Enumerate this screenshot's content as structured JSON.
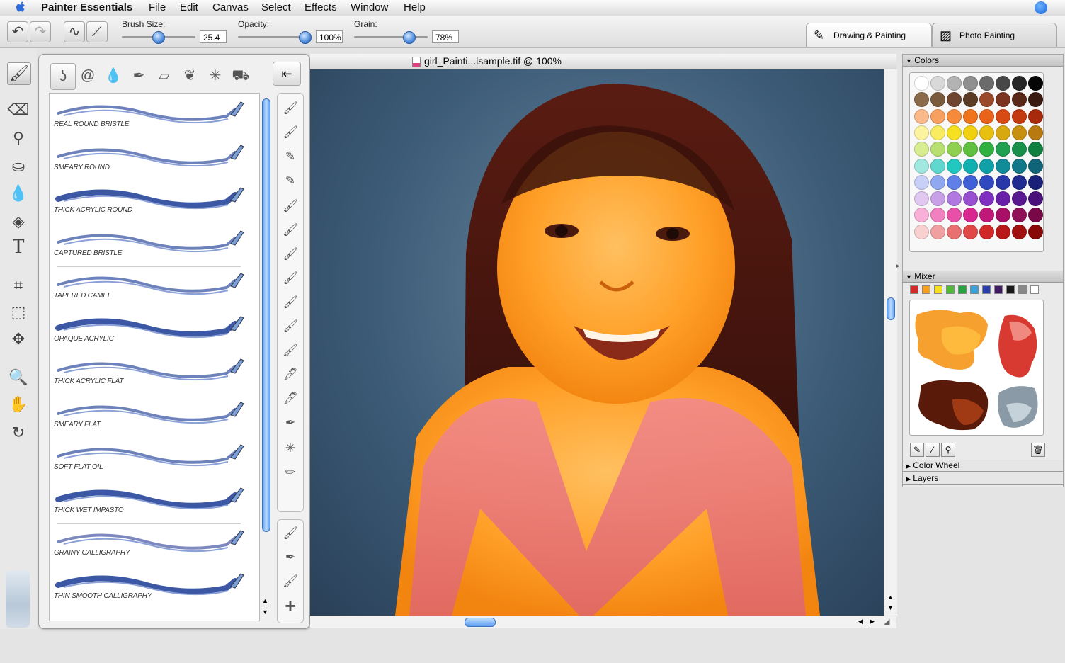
{
  "menubar": {
    "app": "Painter Essentials",
    "items": [
      "File",
      "Edit",
      "Canvas",
      "Select",
      "Effects",
      "Window",
      "Help"
    ]
  },
  "toolbar": {
    "brush_size_label": "Brush Size:",
    "brush_size_value": "25.4",
    "opacity_label": "Opacity:",
    "opacity_value": "100%",
    "grain_label": "Grain:",
    "grain_value": "78%",
    "workspace_tabs": [
      "Drawing & Painting",
      "Photo Painting"
    ]
  },
  "document": {
    "title": "girl_Painti...lsample.tif @ 100%"
  },
  "brushes": [
    "REAL ROUND BRISTLE",
    "SMEARY ROUND",
    "THICK ACRYLIC ROUND",
    "CAPTURED BRISTLE",
    "TAPERED CAMEL",
    "OPAQUE ACRYLIC",
    "THICK ACRYLIC FLAT",
    "SMEARY FLAT",
    "SOFT FLAT OIL",
    "THICK WET IMPASTO",
    "GRAINY CALLIGRAPHY",
    "THIN SMOOTH CALLIGRAPHY"
  ],
  "panels": {
    "colors": "Colors",
    "mixer": "Mixer",
    "color_wheel": "Color Wheel",
    "layers": "Layers"
  },
  "colors": {
    "swatch_rows": [
      [
        "#ffffff",
        "#d9d9d9",
        "#b3b3b3",
        "#8f8f8f",
        "#6b6b6b",
        "#474747",
        "#262626",
        "#050505"
      ],
      [
        "#8a6a4a",
        "#7a5a3c",
        "#6e4630",
        "#5a3c26",
        "#9a4a2a",
        "#7a3420",
        "#5a2818",
        "#3a1a10"
      ],
      [
        "#f9b98a",
        "#f7a060",
        "#f58b3a",
        "#f0741c",
        "#e9631a",
        "#d84a14",
        "#c43a10",
        "#a82a0c"
      ],
      [
        "#fbf3a0",
        "#f9ec60",
        "#f5e120",
        "#f0d010",
        "#e8c010",
        "#d8a810",
        "#c89010",
        "#b87a10"
      ],
      [
        "#d8ec90",
        "#b8e070",
        "#90d050",
        "#60c040",
        "#30b040",
        "#20a050",
        "#18904a",
        "#108040"
      ],
      [
        "#a0e8e0",
        "#60d8d0",
        "#20c8c0",
        "#10b0b0",
        "#10a0a8",
        "#108c98",
        "#107888",
        "#106478"
      ],
      [
        "#c8d0f8",
        "#90a8f0",
        "#6080e8",
        "#4060d8",
        "#3048c0",
        "#2838a8",
        "#202c90",
        "#182078"
      ],
      [
        "#e0c8f0",
        "#c8a0e8",
        "#b078e0",
        "#9850d0",
        "#8030c0",
        "#6820a8",
        "#581890",
        "#481078"
      ],
      [
        "#f8b0d8",
        "#f080c0",
        "#e850a8",
        "#d82890",
        "#c01878",
        "#a81068",
        "#901058",
        "#780848"
      ],
      [
        "#f8d0d0",
        "#f0a0a0",
        "#e87070",
        "#e04848",
        "#d02828",
        "#b81818",
        "#a01010",
        "#880808"
      ]
    ],
    "mixer_strip": [
      "#d22a2a",
      "#f2a020",
      "#f4e020",
      "#52b83a",
      "#2aa040",
      "#3aa0d8",
      "#2a40a8",
      "#401a60",
      "#181818",
      "#888888",
      "#ffffff"
    ]
  }
}
